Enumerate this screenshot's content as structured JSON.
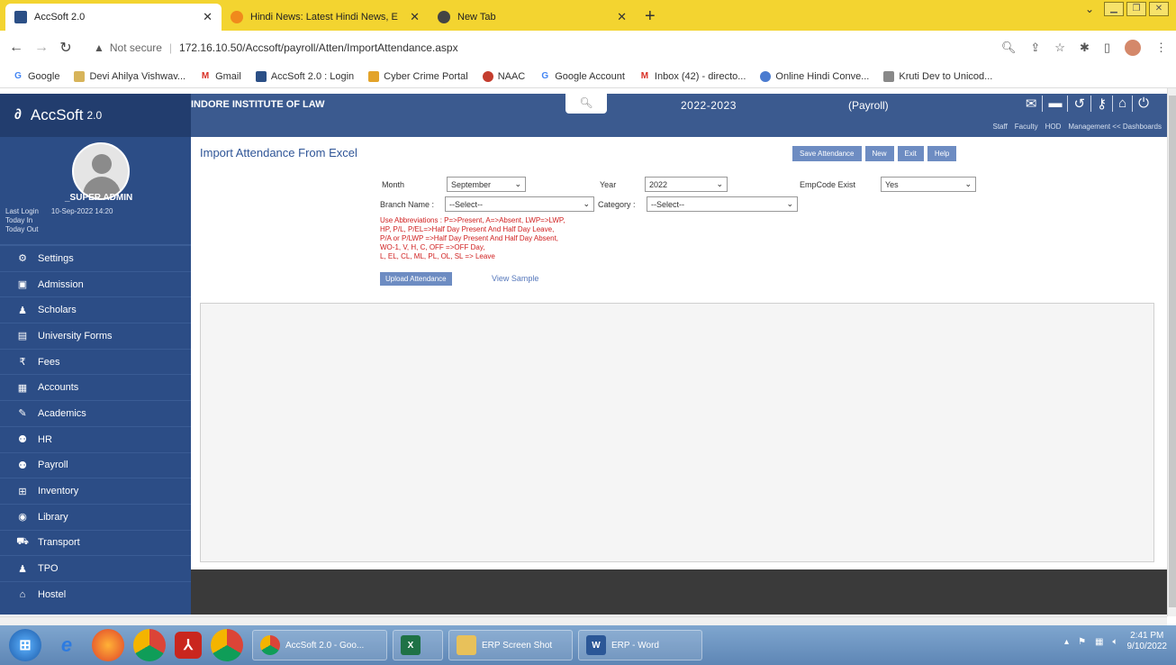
{
  "browser": {
    "tabs": [
      {
        "title": "AccSoft 2.0",
        "active": true
      },
      {
        "title": "Hindi News: Latest Hindi News, E",
        "active": false
      },
      {
        "title": "New Tab",
        "active": false
      }
    ],
    "new_tab_label": "+",
    "security_label": "Not secure",
    "url": "172.16.10.50/Accsoft/payroll/Atten/ImportAttendance.aspx",
    "bookmarks": [
      {
        "label": "Google",
        "icon": "google-icon"
      },
      {
        "label": "Devi Ahilya Vishwav...",
        "icon": "university-icon"
      },
      {
        "label": "Gmail",
        "icon": "gmail-icon"
      },
      {
        "label": "AccSoft 2.0 : Login",
        "icon": "accsoft-icon"
      },
      {
        "label": "Cyber Crime Portal",
        "icon": "portal-icon"
      },
      {
        "label": "NAAC",
        "icon": "naac-icon"
      },
      {
        "label": "Google Account",
        "icon": "google-icon"
      },
      {
        "label": "Inbox (42) - directo...",
        "icon": "gmail-icon"
      },
      {
        "label": "Online Hindi Conve...",
        "icon": "converter-icon"
      },
      {
        "label": "Kruti Dev to Unicod...",
        "icon": "kruti-icon"
      }
    ]
  },
  "app": {
    "name": "AccSoft",
    "version": "2.0",
    "institute": "INDORE INSTITUTE OF LAW",
    "session": "2022-2023",
    "module": "(Payroll)",
    "header_links": [
      "Staff",
      "Faculty",
      "HOD",
      "Management << Dashboards"
    ]
  },
  "user": {
    "name": "_SUPER ADMIN",
    "last_login_label": "Last Login",
    "last_login_value": "10-Sep-2022 14:20",
    "today_in_label": "Today In",
    "today_out_label": "Today Out"
  },
  "sidebar": {
    "items": [
      {
        "label": "Settings",
        "icon": "settings-icon"
      },
      {
        "label": "Admission",
        "icon": "admission-icon"
      },
      {
        "label": "Scholars",
        "icon": "scholars-icon"
      },
      {
        "label": "University Forms",
        "icon": "forms-icon"
      },
      {
        "label": "Fees",
        "icon": "rupee-icon"
      },
      {
        "label": "Accounts",
        "icon": "accounts-icon"
      },
      {
        "label": "Academics",
        "icon": "academics-icon"
      },
      {
        "label": "HR",
        "icon": "hr-icon"
      },
      {
        "label": "Payroll",
        "icon": "payroll-icon"
      },
      {
        "label": "Inventory",
        "icon": "inventory-icon"
      },
      {
        "label": "Library",
        "icon": "library-icon"
      },
      {
        "label": "Transport",
        "icon": "transport-icon"
      },
      {
        "label": "TPO",
        "icon": "tpo-icon"
      },
      {
        "label": "Hostel",
        "icon": "hostel-icon"
      }
    ]
  },
  "page": {
    "title": "Import Attendance From Excel",
    "actions": [
      "Save Attendance",
      "New",
      "Exit",
      "Help"
    ],
    "month_label": "Month",
    "month_value": "September",
    "year_label": "Year",
    "year_value": "2022",
    "empcode_label": "EmpCode Exist",
    "empcode_value": "Yes",
    "branch_label": "Branch Name :",
    "branch_value": "--Select--",
    "category_label": "Category :",
    "category_value": "--Select--",
    "notes": [
      "Use Abbreviations : P=>Present, A=>Absent, LWP=>LWP,",
      "HP, P/L, P/EL=>Half Day Present And Half Day Leave,",
      "P/A or P/LWP =>Half Day Present And Half Day Absent,",
      "WO-1, V, H, C, OFF =>OFF Day,",
      "L, EL, CL, ML, PL, OL, SL => Leave"
    ],
    "upload_label": "Upload Attendance",
    "view_sample_label": "View Sample"
  },
  "taskbar": {
    "tasks": [
      {
        "label": "AccSoft 2.0 - Goo...",
        "icon": "chrome-icon"
      },
      {
        "label": "",
        "icon": "excel-icon"
      },
      {
        "label": "ERP Screen Shot",
        "icon": "folder-icon"
      },
      {
        "label": "ERP - Word",
        "icon": "word-icon"
      }
    ],
    "time": "2:41 PM",
    "date": "9/10/2022"
  },
  "colors": {
    "tabstrip": "#f3d430",
    "header": "#3b5a8f",
    "sidebar": "#2c4d86",
    "notes": "#d02020",
    "button": "#6d8cc2"
  }
}
